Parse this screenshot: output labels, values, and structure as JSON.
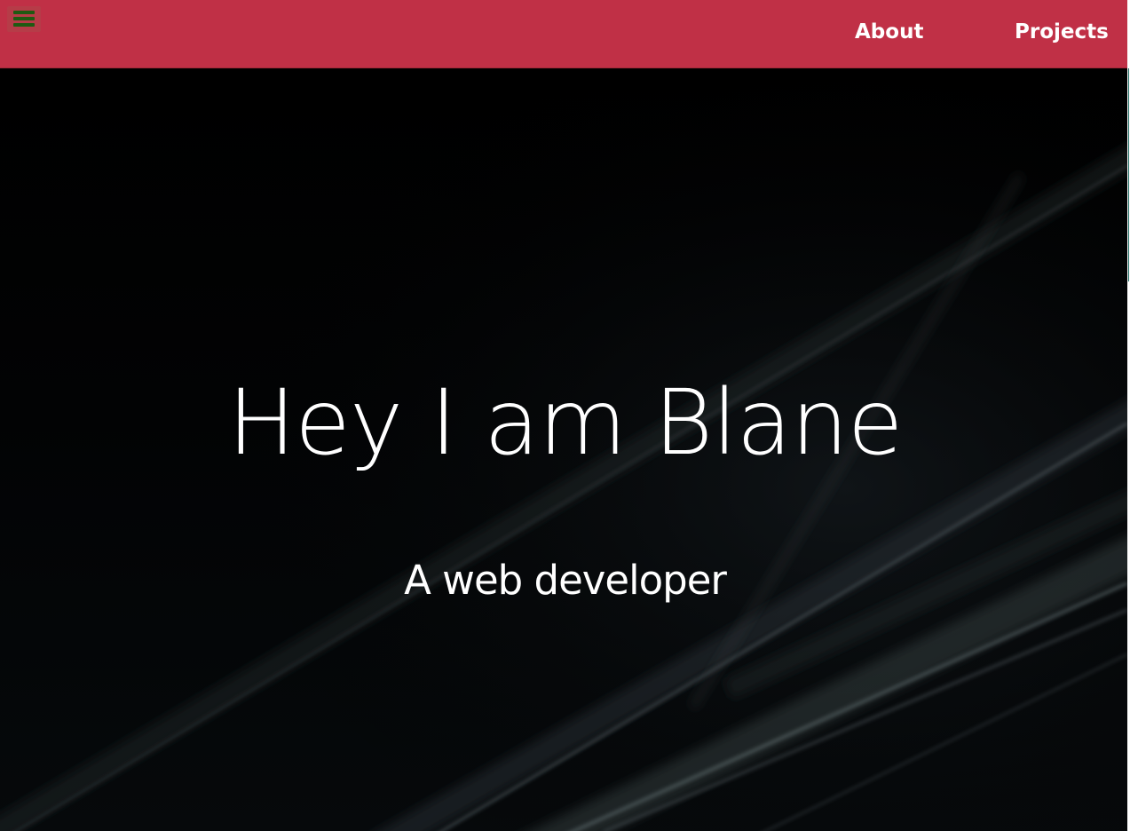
{
  "nav": {
    "menu_icon": "hamburger-menu-icon",
    "links": [
      {
        "label": "About"
      },
      {
        "label": "Projects"
      }
    ]
  },
  "hero": {
    "title": "Hey I am Blane",
    "subtitle": "A web developer"
  },
  "colors": {
    "navbar": "#c03046",
    "menu_icon": "#1f5a12",
    "hero_background": "#000000",
    "text": "#ffffff"
  }
}
